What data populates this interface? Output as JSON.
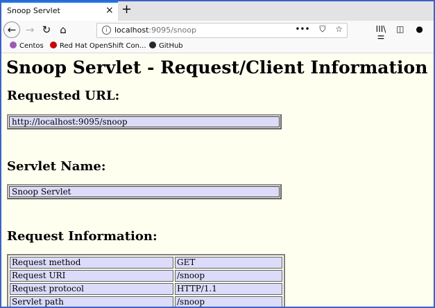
{
  "tab": {
    "title": "Snoop Servlet",
    "close": "×",
    "new": "+"
  },
  "nav": {
    "back": "←",
    "forward": "→",
    "reload": "↻",
    "home": "⌂",
    "url_host": "localhost",
    "url_rest": ":9095/snoop",
    "more": "•••",
    "library": "III\\",
    "sidebar": "◫",
    "menu": "☰"
  },
  "bookmarks": [
    {
      "label": "Centos",
      "color": "#9c5bb5"
    },
    {
      "label": "Red Hat OpenShift Con...",
      "color": "#cc0000"
    },
    {
      "label": "GitHub",
      "color": "#24292e"
    }
  ],
  "page": {
    "title": "Snoop Servlet - Request/Client Information",
    "requested_url_heading": "Requested URL:",
    "requested_url": "http://localhost:9095/snoop",
    "servlet_name_heading": "Servlet Name:",
    "servlet_name": "Snoop Servlet",
    "request_info_heading": "Request Information:",
    "request_info": [
      {
        "key": "Request method",
        "value": "GET"
      },
      {
        "key": "Request URI",
        "value": "/snoop"
      },
      {
        "key": "Request protocol",
        "value": "HTTP/1.1"
      },
      {
        "key": "Servlet path",
        "value": "/snoop"
      }
    ]
  }
}
